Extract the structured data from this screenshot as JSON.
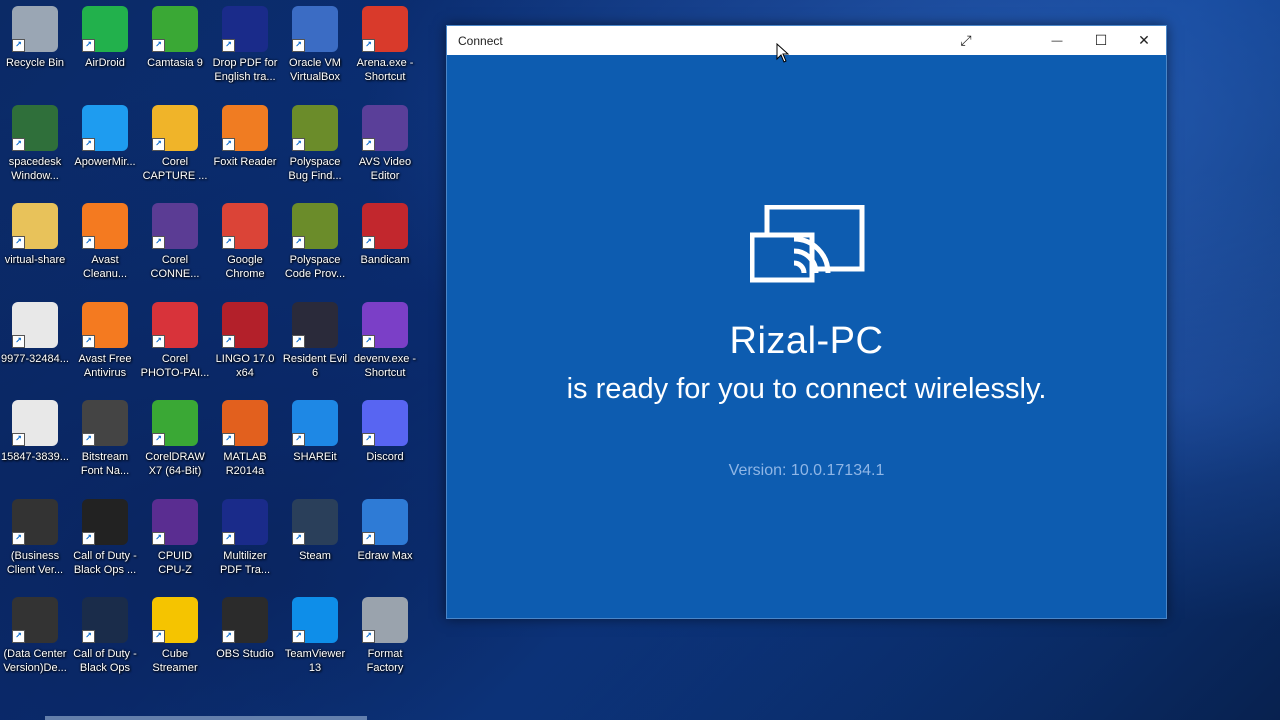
{
  "desktop": {
    "icons": [
      {
        "label": "Recycle Bin",
        "icon": "recycle-bin-icon",
        "color": "#9aa6b4"
      },
      {
        "label": "AirDroid",
        "icon": "airdroid-icon",
        "color": "#22b14c"
      },
      {
        "label": "Camtasia 9",
        "icon": "camtasia-icon",
        "color": "#3aa835"
      },
      {
        "label": "Drop PDF for\nEnglish tra...",
        "icon": "pdf-m-icon",
        "color": "#1a2b8a"
      },
      {
        "label": "Oracle VM\nVirtualBox",
        "icon": "virtualbox-icon",
        "color": "#3b6cc4"
      },
      {
        "label": "Arena.exe -\nShortcut",
        "icon": "arena-icon",
        "color": "#d93a2b"
      },
      {
        "label": "spacedesk\nWindow...",
        "icon": "spacedesk-icon",
        "color": "#2f6f3a"
      },
      {
        "label": "ApowerMir...",
        "icon": "apowermirror-icon",
        "color": "#1e9cf0"
      },
      {
        "label": "Corel\nCAPTURE ...",
        "icon": "corel-capture-icon",
        "color": "#f0b429"
      },
      {
        "label": "Foxit Reader",
        "icon": "foxit-icon",
        "color": "#f07c22"
      },
      {
        "label": "Polyspace\nBug Find...",
        "icon": "polyspace-icon",
        "color": "#6b8c2a"
      },
      {
        "label": "AVS Video\nEditor",
        "icon": "avs-video-icon",
        "color": "#5a3f99"
      },
      {
        "label": "virtual-share",
        "icon": "folder-icon",
        "color": "#e8c25a"
      },
      {
        "label": "Avast\nCleanu...",
        "icon": "avast-cleanup-icon",
        "color": "#f47a20"
      },
      {
        "label": "Corel\nCONNE...",
        "icon": "corel-connect-icon",
        "color": "#5b3c94"
      },
      {
        "label": "Google\nChrome",
        "icon": "chrome-icon",
        "color": "#db4437"
      },
      {
        "label": "Polyspace\nCode Prov...",
        "icon": "polyspace-code-icon",
        "color": "#6b8c2a"
      },
      {
        "label": "Bandicam",
        "icon": "bandicam-icon",
        "color": "#c2272d"
      },
      {
        "label": "9977-32484...",
        "icon": "document-icon",
        "color": "#e8e8e8"
      },
      {
        "label": "Avast Free\nAntivirus",
        "icon": "avast-icon",
        "color": "#f47a20"
      },
      {
        "label": "Corel\nPHOTO-PAI...",
        "icon": "corel-photopaint-icon",
        "color": "#d8333a"
      },
      {
        "label": "LINGO 17.0\nx64",
        "icon": "lingo-icon",
        "color": "#b3202a"
      },
      {
        "label": "Resident Evil\n6",
        "icon": "resident-evil-icon",
        "color": "#2a2a3a"
      },
      {
        "label": "devenv.exe -\nShortcut",
        "icon": "visual-studio-icon",
        "color": "#7b3fc7"
      },
      {
        "label": "15847-3839...",
        "icon": "document-icon",
        "color": "#e8e8e8"
      },
      {
        "label": "Bitstream\nFont Na...",
        "icon": "bitstream-icon",
        "color": "#444"
      },
      {
        "label": "CorelDRAW\nX7 (64-Bit)",
        "icon": "coreldraw-icon",
        "color": "#3aa835"
      },
      {
        "label": "MATLAB\nR2014a",
        "icon": "matlab-icon",
        "color": "#e2601e"
      },
      {
        "label": "SHAREit",
        "icon": "shareit-icon",
        "color": "#1e88e5"
      },
      {
        "label": "Discord",
        "icon": "discord-icon",
        "color": "#5865f2"
      },
      {
        "label": "(Business\nClient Ver...",
        "icon": "dell-icon",
        "color": "#333"
      },
      {
        "label": "Call of Duty -\nBlack Ops ...",
        "icon": "cod-icon",
        "color": "#222"
      },
      {
        "label": "CPUID\nCPU-Z",
        "icon": "cpuz-icon",
        "color": "#5a2d91"
      },
      {
        "label": "Multilizer\nPDF Tra...",
        "icon": "multilizer-icon",
        "color": "#1a2b8a"
      },
      {
        "label": "Steam",
        "icon": "steam-icon",
        "color": "#2a3f5a"
      },
      {
        "label": "Edraw Max",
        "icon": "edraw-icon",
        "color": "#2e7bd6"
      },
      {
        "label": "(Data Center\nVersion)De...",
        "icon": "dell-icon",
        "color": "#333"
      },
      {
        "label": "Call of Duty -\nBlack Ops",
        "icon": "cod-icon",
        "color": "#1a2c4a"
      },
      {
        "label": "Cube\nStreamer",
        "icon": "cube-streamer-icon",
        "color": "#f5c400"
      },
      {
        "label": "OBS Studio",
        "icon": "obs-icon",
        "color": "#2b2b2b"
      },
      {
        "label": "TeamViewer\n13",
        "icon": "teamviewer-icon",
        "color": "#0e8ee9"
      },
      {
        "label": "Format\nFactory",
        "icon": "format-factory-icon",
        "color": "#9aa3ad"
      }
    ]
  },
  "window": {
    "title": "Connect",
    "fullscreen_icon": "⤢",
    "minimize_icon": "—",
    "maximize_icon": "☐",
    "close_icon": "✕"
  },
  "connect": {
    "device_name": "Rizal-PC",
    "message": "is ready for you to connect wirelessly.",
    "version": "Version: 10.0.17134.1"
  }
}
